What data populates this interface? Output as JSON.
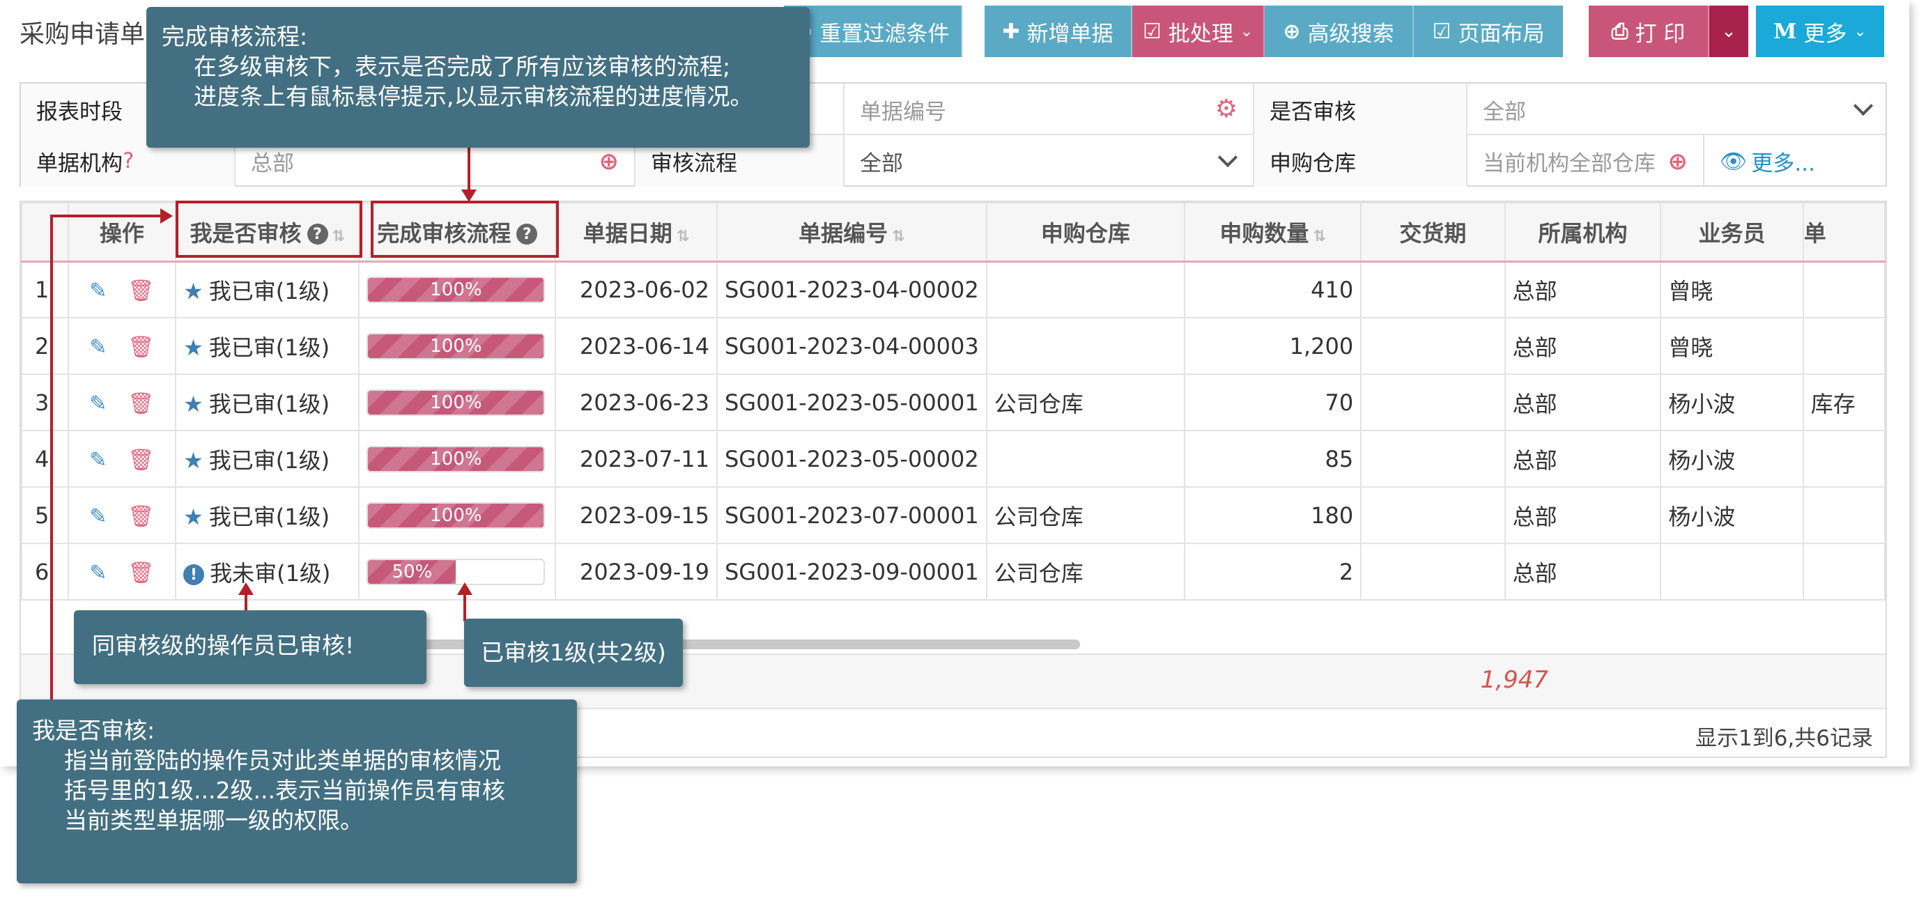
{
  "page_title": "采购申请单",
  "toolbar": {
    "reset_filter": "重置过滤条件",
    "new_doc": "新增单据",
    "batch": "批处理",
    "advanced_search": "高级搜索",
    "page_layout": "页面布局",
    "print": "打 印",
    "more": "更多"
  },
  "filter": {
    "report_period_label": "报表时段",
    "doc_no_placeholder": "单据编号",
    "audited_label": "是否审核",
    "audited_value": "全部",
    "org_label": "单据机构",
    "org_q": "?",
    "org_value": "总部",
    "flow_label": "审核流程",
    "flow_value": "全部",
    "warehouse_label": "申购仓库",
    "warehouse_placeholder": "当前机构全部仓库",
    "more": "更多..."
  },
  "table": {
    "headers": [
      "操作",
      "我是否审核",
      "完成审核流程",
      "单据日期",
      "单据编号",
      "申购仓库",
      "申购数量",
      "交货期",
      "所属机构",
      "业务员",
      "单"
    ],
    "rows": [
      {
        "idx": "1",
        "audit": "我已审(1级)",
        "audited": true,
        "progress": 100,
        "progress_label": "100%",
        "date": "2023-06-02",
        "no": "SG001-2023-04-00002",
        "warehouse": "",
        "qty": "410",
        "delivery": "",
        "org": "总部",
        "staff": "曾晓",
        "extra": ""
      },
      {
        "idx": "2",
        "audit": "我已审(1级)",
        "audited": true,
        "progress": 100,
        "progress_label": "100%",
        "date": "2023-06-14",
        "no": "SG001-2023-04-00003",
        "warehouse": "",
        "qty": "1,200",
        "delivery": "",
        "org": "总部",
        "staff": "曾晓",
        "extra": ""
      },
      {
        "idx": "3",
        "audit": "我已审(1级)",
        "audited": true,
        "progress": 100,
        "progress_label": "100%",
        "date": "2023-06-23",
        "no": "SG001-2023-05-00001",
        "warehouse": "公司仓库",
        "qty": "70",
        "delivery": "",
        "org": "总部",
        "staff": "杨小波",
        "extra": "库存"
      },
      {
        "idx": "4",
        "audit": "我已审(1级)",
        "audited": true,
        "progress": 100,
        "progress_label": "100%",
        "date": "2023-07-11",
        "no": "SG001-2023-05-00002",
        "warehouse": "",
        "qty": "85",
        "delivery": "",
        "org": "总部",
        "staff": "杨小波",
        "extra": ""
      },
      {
        "idx": "5",
        "audit": "我已审(1级)",
        "audited": true,
        "progress": 100,
        "progress_label": "100%",
        "date": "2023-09-15",
        "no": "SG001-2023-07-00001",
        "warehouse": "公司仓库",
        "qty": "180",
        "delivery": "",
        "org": "总部",
        "staff": "杨小波",
        "extra": ""
      },
      {
        "idx": "6",
        "audit": "我未审(1级)",
        "audited": false,
        "progress": 50,
        "progress_label": "50%",
        "date": "2023-09-19",
        "no": "SG001-2023-09-00001",
        "warehouse": "公司仓库",
        "qty": "2",
        "delivery": "",
        "org": "总部",
        "staff": "",
        "extra": ""
      }
    ],
    "total_qty": "1,947",
    "pager": "显示1到6,共6记录"
  },
  "callouts": {
    "flow_title": "完成审核流程:",
    "flow_line1": "在多级审核下，表示是否完成了所有应该审核的流程;",
    "flow_line2": "进度条上有鼠标悬停提示,以显示审核流程的进度情况。",
    "same_level": "同审核级的操作员已审核!",
    "audited_level": "已审核1级(共2级)",
    "me_title": "我是否审核:",
    "me_line1": "指当前登陆的操作员对此类单据的审核情况",
    "me_line2": "括号里的1级...2级...表示当前操作员有审核",
    "me_line3": "当前类型单据哪一级的权限。"
  },
  "colors": {
    "teal_button": "#5aaac6",
    "rose_button": "#c9567a",
    "cyan_button": "#1aa9d8",
    "callout_bg": "#436f82",
    "highlight": "#b3202a",
    "progress": "#c6587a"
  }
}
